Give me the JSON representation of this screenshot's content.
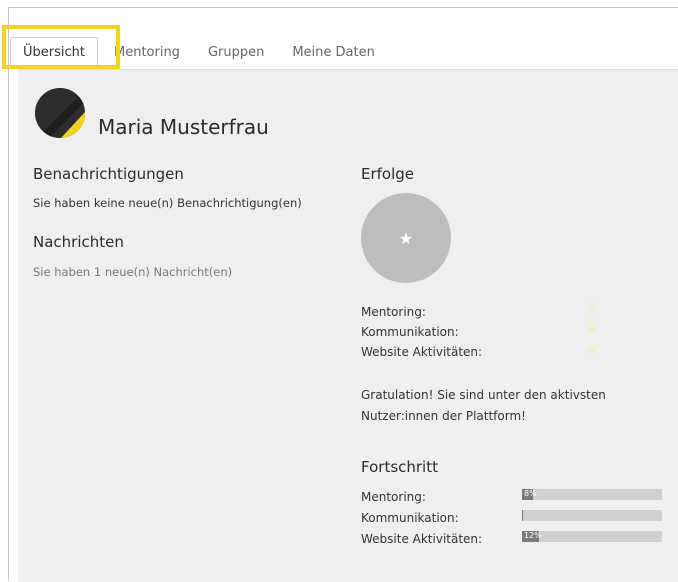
{
  "tabs": [
    {
      "label": "Übersicht",
      "active": true
    },
    {
      "label": "Mentoring",
      "active": false
    },
    {
      "label": "Gruppen",
      "active": false
    },
    {
      "label": "Meine Daten",
      "active": false
    }
  ],
  "profile": {
    "name": "Maria Musterfrau"
  },
  "notifications": {
    "heading": "Benachrichtigungen",
    "text": "Sie haben keine neue(n) Benachrichtigung(en)"
  },
  "messages": {
    "heading": "Nachrichten",
    "text": "Sie haben 1 neue(n) Nachricht(en)"
  },
  "achievements": {
    "heading": "Erfolge",
    "rows": [
      {
        "label": "Mentoring:"
      },
      {
        "label": "Kommunikation:"
      },
      {
        "label": "Website Aktivitäten:"
      }
    ],
    "congrats_line1": "Gratulation! Sie sind unter den aktivsten",
    "congrats_line2": "Nutzer:innen der Plattform!"
  },
  "progress": {
    "heading": "Fortschritt",
    "rows": [
      {
        "label": "Mentoring:",
        "value_text": "8%",
        "value": 8
      },
      {
        "label": "Kommunikation:",
        "value_text": "",
        "value": 1
      },
      {
        "label": "Website Aktivitäten:",
        "value_text": "12%",
        "value": 12
      }
    ]
  },
  "colors": {
    "highlight": "#f5d31a",
    "avatar_accent": "#f5d31a",
    "panel": "#efefef"
  }
}
